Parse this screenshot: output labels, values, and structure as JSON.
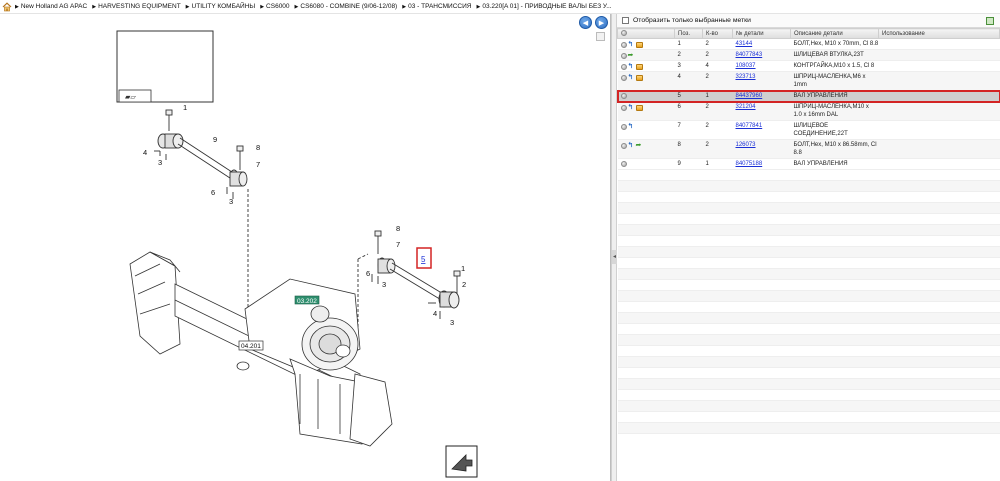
{
  "breadcrumb": {
    "items": [
      "New Holland AG APAC",
      "HARVESTING EQUIPMENT",
      "UTILITY КОМБАЙНЫ",
      "CS6000",
      "CS6080 - COMBINE (9/06-12/08)",
      "03 - ТРАНСМИССИЯ",
      "03.220[A 01] - ПРИВОДНЫЕ ВАЛЫ БЕЗ У..."
    ]
  },
  "diagram": {
    "callouts": {
      "c1a": "1",
      "c9": "9",
      "c4a": "4",
      "c3a": "3",
      "c8a": "8",
      "c7a": "7",
      "c6a": "6",
      "c3b": "3",
      "c8b": "8",
      "c7b": "7",
      "c6b": "6",
      "c3c": "3",
      "c5": "5",
      "c1b": "1",
      "c2": "2",
      "c4b": "4",
      "c3d": "3"
    },
    "ref_03_202": "03.202",
    "ref_04_201": "04.201"
  },
  "parts_panel": {
    "filter_label": "Отобразить только выбранные метки",
    "columns": [
      "",
      "Поз.",
      "К-во",
      "№ детали",
      "Описание детали",
      "Использование"
    ],
    "rows": [
      {
        "icons": [
          "circle",
          "blue",
          "orange"
        ],
        "pos": "1",
        "qty": "2",
        "part": "43144",
        "desc": "БОЛТ,Hex, M10 x 70mm, Cl 8.8"
      },
      {
        "icons": [
          "circle",
          "green"
        ],
        "pos": "2",
        "qty": "2",
        "part": "84077843",
        "desc": "ШЛИЦЕВАЯ ВТУЛКА,23T"
      },
      {
        "icons": [
          "circle",
          "blue",
          "orange"
        ],
        "pos": "3",
        "qty": "4",
        "part": "108037",
        "desc": "КОНТРГАЙКА,M10 x 1.5, Cl 8"
      },
      {
        "icons": [
          "circle",
          "blue",
          "orange"
        ],
        "pos": "4",
        "qty": "2",
        "part": "323713",
        "desc": "ШПРИЦ-МАСЛЕНКА,M6 x 1mm"
      },
      {
        "icons": [
          "circle"
        ],
        "pos": "5",
        "qty": "1",
        "part": "84437960",
        "desc": "ВАЛ УПРАВЛЕНИЯ"
      },
      {
        "icons": [
          "circle",
          "blue",
          "orange"
        ],
        "pos": "6",
        "qty": "2",
        "part": "321204",
        "desc": "ШПРИЦ-МАСЛЕНКА,M10 x 1.0 x 16mm DAL"
      },
      {
        "icons": [
          "circle",
          "blue"
        ],
        "pos": "7",
        "qty": "2",
        "part": "84077841",
        "desc": "ШЛИЦЕВОЕ СОЕДИНЕНИЕ,22T"
      },
      {
        "icons": [
          "circle",
          "blue",
          "green"
        ],
        "pos": "8",
        "qty": "2",
        "part": "126073",
        "desc": "БОЛТ,Hex, M10 x 86.58mm, Cl 8.8"
      },
      {
        "icons": [
          "circle"
        ],
        "pos": "9",
        "qty": "1",
        "part": "84075188",
        "desc": "ВАЛ УПРАВЛЕНИЯ"
      }
    ],
    "selected_index": 4
  },
  "colors": {
    "link": "#1a2fd6",
    "selection_outline": "#d32424",
    "nav_button": "#2e6fc4",
    "ref_label_bg": "#2f8f6f"
  }
}
